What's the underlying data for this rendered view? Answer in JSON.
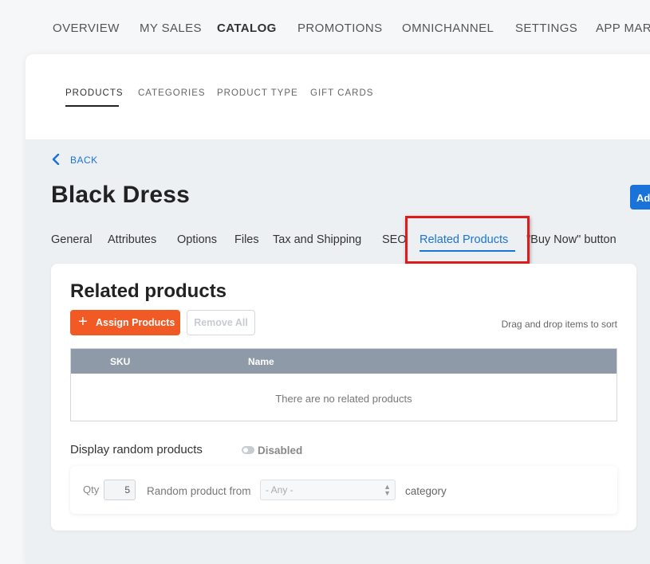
{
  "top_nav": [
    "OVERVIEW",
    "MY SALES",
    "CATALOG",
    "PROMOTIONS",
    "OMNICHANNEL",
    "SETTINGS",
    "APP MARK"
  ],
  "sub_tabs": [
    "PRODUCTS",
    "CATEGORIES",
    "PRODUCT TYPE",
    "GIFT CARDS"
  ],
  "back_label": "BACK",
  "product_title": "Black Dress",
  "add_button": "Ad",
  "product_tabs": [
    "General",
    "Attributes",
    "Options",
    "Files",
    "Tax and Shipping",
    "SEO",
    "Related Products",
    "\"Buy Now\" button"
  ],
  "active_product_tab": "Related Products",
  "related": {
    "title": "Related products",
    "assign_button": "Assign Products",
    "remove_button": "Remove All",
    "hint": "Drag and drop items to sort",
    "columns": [
      "SKU",
      "Name"
    ],
    "empty_text": "There are no related products"
  },
  "random": {
    "label": "Display random products",
    "toggle_state": "Disabled",
    "qty_label": "Qty",
    "qty_value": "5",
    "from_label": "Random product from",
    "select_value": "- Any -",
    "suffix": "category"
  },
  "colors": {
    "accent_blue": "#1a73d9",
    "assign_orange": "#f15a24",
    "highlight_red": "#e01b1b",
    "table_header": "#8e9aa8"
  },
  "icons": [
    "chevron-left-icon",
    "plus-icon",
    "select-arrows-icon",
    "toggle-icon"
  ]
}
